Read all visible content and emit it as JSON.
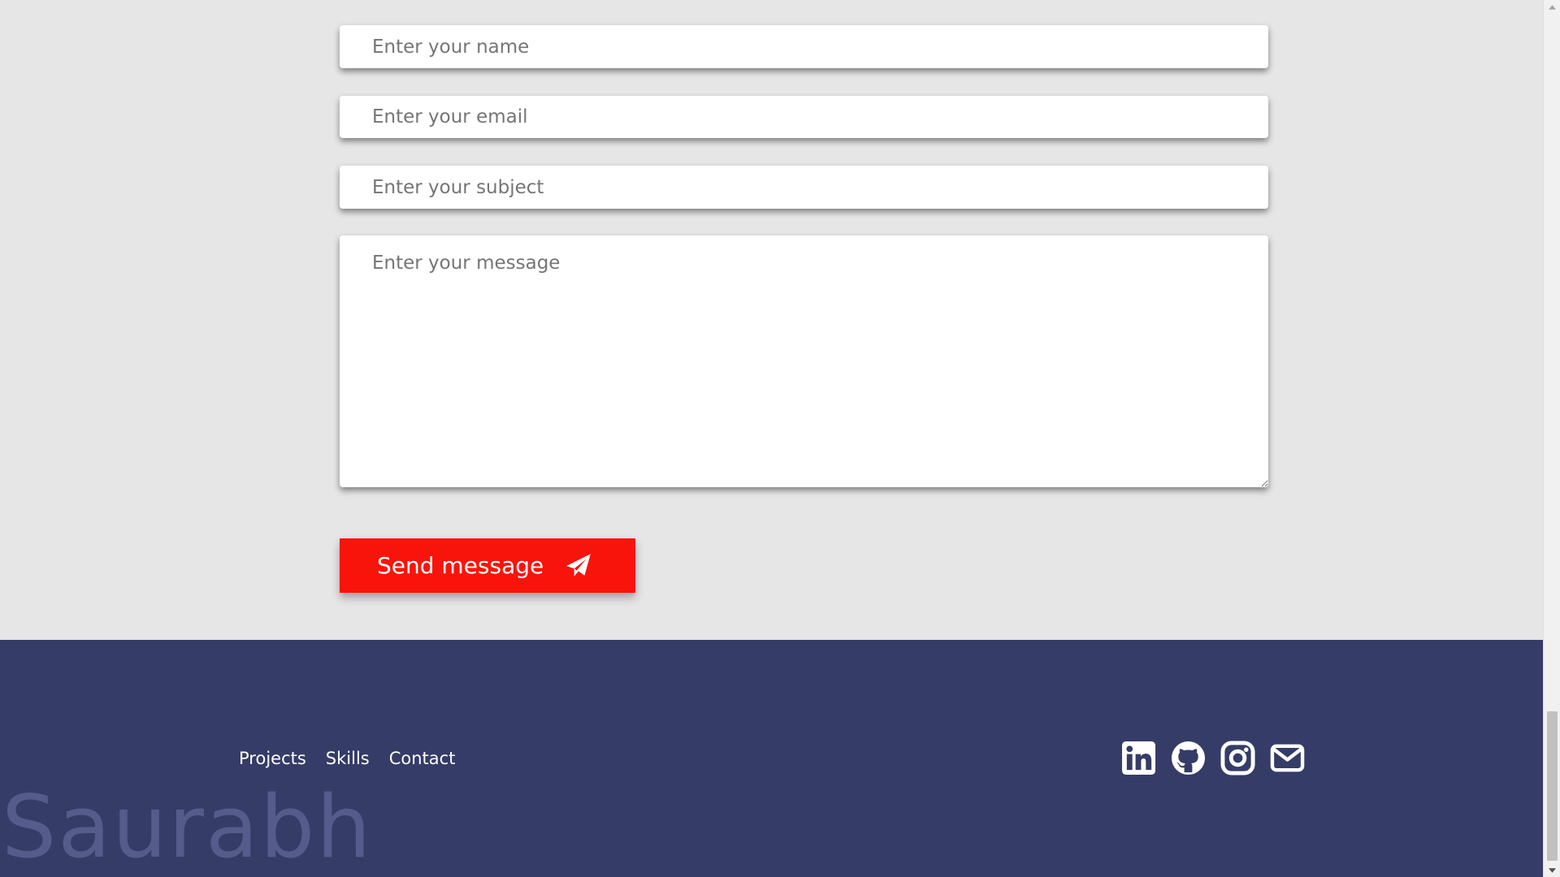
{
  "contact_form": {
    "name_placeholder": "Enter your name",
    "email_placeholder": "Enter your email",
    "subject_placeholder": "Enter your subject",
    "message_placeholder": "Enter your message",
    "send_label": "Send message",
    "send_icon": "paper-plane-icon",
    "send_color": "#f9140b"
  },
  "footer": {
    "background": "#353c67",
    "nav": {
      "projects": "Projects",
      "skills": "Skills",
      "contact": "Contact"
    },
    "social_icons": [
      "linkedin-icon",
      "github-icon",
      "instagram-icon",
      "email-icon"
    ],
    "brand": "Saurabh"
  },
  "colors": {
    "page_background": "#e6e6e6",
    "watermark": "#555c8c"
  }
}
